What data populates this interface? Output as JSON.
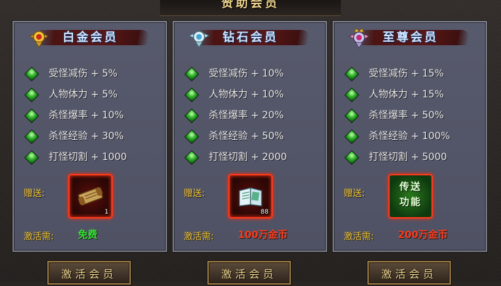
{
  "window": {
    "title": "赞助会员"
  },
  "colors": {
    "free": "#35e335",
    "price": "#ff3a1a",
    "label_gold": "#f3c535",
    "gem_green": "#2fb42a"
  },
  "tiers": [
    {
      "name": "白金会员",
      "emblem": "gold-wing-badge-icon",
      "stats": [
        "受怪减伤 + 5%",
        "人物体力 + 5%",
        "杀怪爆率 + 10%",
        "杀怪经验 + 30%",
        "打怪切割 + 1000"
      ],
      "gift_label": "赠送:",
      "gift_icon": "scroll-icon",
      "gift_count": "1",
      "gift_text": "",
      "cost_label": "激活需:",
      "cost": "免费",
      "cost_color": "#35e335",
      "button": "激活会员"
    },
    {
      "name": "钻石会员",
      "emblem": "diamond-wing-badge-icon",
      "stats": [
        "受怪减伤 + 10%",
        "人物体力 + 10%",
        "杀怪爆率 + 20%",
        "杀怪经验 + 50%",
        "打怪切割 + 2000"
      ],
      "gift_label": "赠送:",
      "gift_icon": "book-icon",
      "gift_count": "88",
      "gift_text": "",
      "cost_label": "激活需:",
      "cost": "100万金币",
      "cost_color": "#ff3a1a",
      "button": "激活会员"
    },
    {
      "name": "至尊会员",
      "emblem": "crown-wing-badge-icon",
      "stats": [
        "受怪减伤 + 15%",
        "人物体力 + 15%",
        "杀怪爆率 + 50%",
        "杀怪经验 + 100%",
        "打怪切割 + 5000"
      ],
      "gift_label": "赠送:",
      "gift_icon": "teleport-icon",
      "gift_count": "",
      "gift_text": "传送\n功能",
      "cost_label": "激活需:",
      "cost": "200万金币",
      "cost_color": "#ff3a1a",
      "button": "激活会员"
    }
  ]
}
